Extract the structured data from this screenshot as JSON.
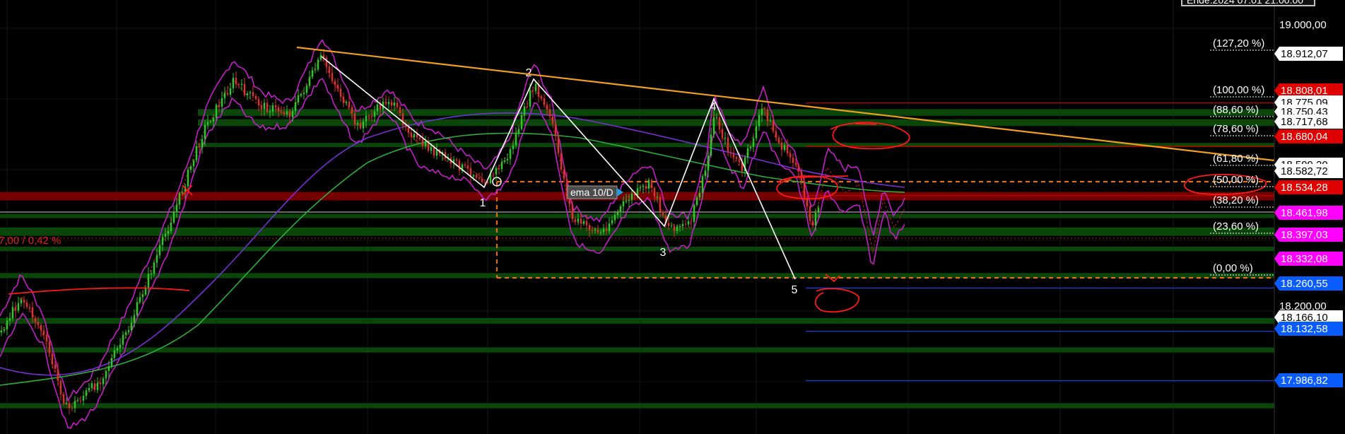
{
  "header": {
    "label": "Ende:2024 07.01 21:00:00"
  },
  "left_label": "7,00 / 0,42 %",
  "ema_label": "ema 10/D",
  "wave_labels": [
    "1",
    "2",
    "3",
    "4",
    "5"
  ],
  "axis_labels": [
    "19.000,00",
    "18.200,00"
  ],
  "colors": {
    "background": "#000000",
    "zone": "#0b4a0b",
    "zone_red": "#8a0000",
    "trend": "#f0a020",
    "wave": "#ffffff",
    "bollinger": "#c41ec8",
    "ema_green": "#2eae3a",
    "ema_purple": "#7a2fd6",
    "annotation": "#ff1a1a",
    "bull": "#22d022",
    "bear": "#e03030",
    "tag_red": "#e00000",
    "tag_magenta": "#ff00ff",
    "tag_blue": "#0a5cff",
    "tag_white": "#ffffff"
  },
  "chart_data": {
    "type": "line",
    "ylim": [
      17900,
      19050
    ],
    "price_tags": [
      {
        "label": "18.912,07",
        "value": 18912.07,
        "style": "white"
      },
      {
        "label": "18.808,01",
        "value": 18808.01,
        "style": "red"
      },
      {
        "label": "18.775,09",
        "value": 18775.09,
        "style": "white"
      },
      {
        "label": "18.750,43",
        "value": 18750.43,
        "style": "white"
      },
      {
        "label": "18.717,68",
        "value": 18717.68,
        "style": "white"
      },
      {
        "label": "18.680,04",
        "value": 18680.04,
        "style": "red"
      },
      {
        "label": "18.599,20",
        "value": 18599.2,
        "style": "white"
      },
      {
        "label": "18.582,72",
        "value": 18582.72,
        "style": "white"
      },
      {
        "label": "18.534,28",
        "value": 18534.28,
        "style": "red"
      },
      {
        "label": "18.461,98",
        "value": 18461.98,
        "style": "magenta"
      },
      {
        "label": "18.397,03",
        "value": 18397.03,
        "style": "magenta"
      },
      {
        "label": "18.332,08",
        "value": 18332.08,
        "style": "magenta"
      },
      {
        "label": "18.260,55",
        "value": 18260.55,
        "style": "blue"
      },
      {
        "label": "18.166,10",
        "value": 18166.1,
        "style": "white"
      },
      {
        "label": "18.132,58",
        "value": 18132.58,
        "style": "blue"
      },
      {
        "label": "17.986,82",
        "value": 17986.82,
        "style": "blue"
      }
    ],
    "fib_levels": [
      {
        "label": "(127,20 %)",
        "value": 18912.07
      },
      {
        "label": "(100,00 %)",
        "value": 18808.01
      },
      {
        "label": "(88,60 %)",
        "value": 18764.4
      },
      {
        "label": "(78,60 %)",
        "value": 18726.1
      },
      {
        "label": "(61,80 %)",
        "value": 18661.9
      },
      {
        "label": "(50,00 %)",
        "value": 18616.7
      },
      {
        "label": "(38,20 %)",
        "value": 18571.6
      },
      {
        "label": "(23,60 %)",
        "value": 18515.7
      },
      {
        "label": "(0,00 %)",
        "value": 18425.4
      }
    ],
    "zones": [
      {
        "from": 18770,
        "to": 18790
      },
      {
        "from": 18740,
        "to": 18760
      },
      {
        "from": 18680,
        "to": 18690
      },
      {
        "from": 18520,
        "to": 18545,
        "red": true
      },
      {
        "from": 18470,
        "to": 18480
      },
      {
        "from": 18415,
        "to": 18440
      },
      {
        "from": 18370,
        "to": 18383
      },
      {
        "from": 18290,
        "to": 18305
      },
      {
        "from": 18155,
        "to": 18172
      },
      {
        "from": 18070,
        "to": 18085
      },
      {
        "from": 17905,
        "to": 17920
      }
    ],
    "ref_lines": [
      {
        "value": 18808.01,
        "color": "red"
      },
      {
        "value": 18680.04,
        "color": "red"
      },
      {
        "value": 18534.28,
        "color": "red"
      },
      {
        "value": 18132.58,
        "color": "blue"
      },
      {
        "value": 17986.82,
        "color": "blue"
      },
      {
        "value": 18260.55,
        "color": "blue"
      }
    ],
    "waves": [
      {
        "label": "1",
        "value": 18520
      },
      {
        "label": "2",
        "value": 18805
      },
      {
        "label": "3",
        "value": 18470
      },
      {
        "label": "4",
        "value": 18780
      },
      {
        "label": "5",
        "value": 18420
      }
    ]
  }
}
